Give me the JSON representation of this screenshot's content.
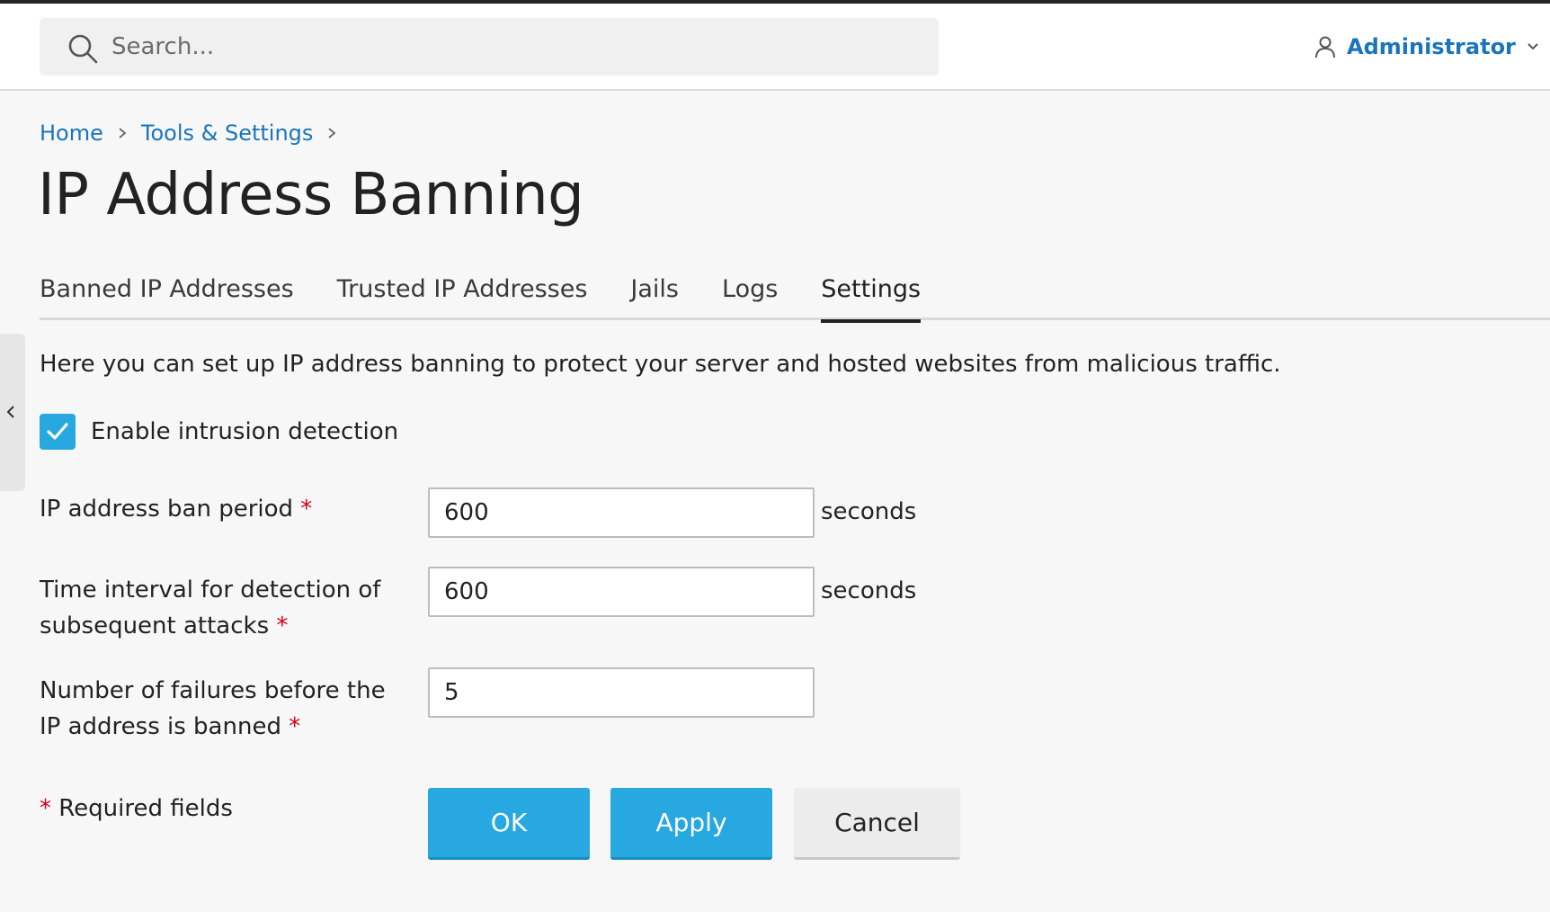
{
  "header": {
    "search_placeholder": "Search...",
    "user_name": "Administrator"
  },
  "breadcrumb": [
    {
      "label": "Home"
    },
    {
      "label": "Tools & Settings"
    }
  ],
  "page_title": "IP Address Banning",
  "tabs": [
    {
      "label": "Banned IP Addresses",
      "active": false
    },
    {
      "label": "Trusted IP Addresses",
      "active": false
    },
    {
      "label": "Jails",
      "active": false
    },
    {
      "label": "Logs",
      "active": false
    },
    {
      "label": "Settings",
      "active": true
    }
  ],
  "description": "Here you can set up IP address banning to protect your server and hosted websites from malicious traffic.",
  "intrusion_detection": {
    "label": "Enable intrusion detection",
    "checked": true
  },
  "fields": {
    "ban_period": {
      "label": "IP address ban period",
      "value": "600",
      "unit": "seconds"
    },
    "detection_interval": {
      "label_line1": "Time interval for detection of",
      "label_line2": "subsequent attacks",
      "value": "600",
      "unit": "seconds"
    },
    "failures": {
      "label_line1": "Number of failures before the",
      "label_line2": "IP address is banned",
      "value": "5"
    }
  },
  "required_marker": "*",
  "required_note": "Required fields",
  "buttons": {
    "ok": "OK",
    "apply": "Apply",
    "cancel": "Cancel"
  },
  "colors": {
    "accent": "#28a8e0",
    "link": "#1b75bb",
    "required": "#d0021b"
  }
}
